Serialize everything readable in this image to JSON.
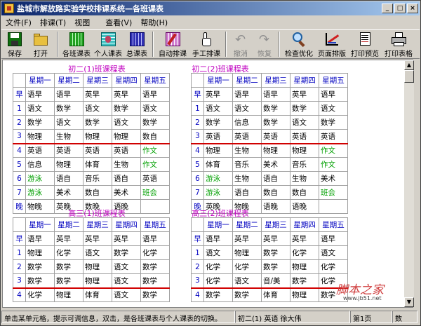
{
  "window": {
    "title": "盐城市解放路实验学校排课系统—各班课表",
    "min": "_",
    "max": "□",
    "close": "×"
  },
  "menu": [
    "文件(F)",
    "排课(T)",
    "视图",
    "查看(V)",
    "帮助(H)"
  ],
  "toolbar": [
    {
      "label": "保存",
      "icon": "save-icon",
      "enabled": true
    },
    {
      "label": "打开",
      "icon": "open-folder-icon",
      "enabled": true
    },
    {
      "label": "各班课表",
      "icon": "class-grid-icon",
      "enabled": true
    },
    {
      "label": "个人课表",
      "icon": "personal-grid-icon",
      "enabled": true
    },
    {
      "label": "总课表",
      "icon": "master-grid-icon",
      "enabled": true
    },
    {
      "label": "自动排课",
      "icon": "auto-schedule-icon",
      "enabled": true
    },
    {
      "label": "手工排课",
      "icon": "hand-pointer-icon",
      "enabled": true
    },
    {
      "label": "撤消",
      "icon": "undo-icon",
      "enabled": false
    },
    {
      "label": "恢复",
      "icon": "redo-icon",
      "enabled": false
    },
    {
      "label": "检查优化",
      "icon": "magnifier-icon",
      "enabled": true
    },
    {
      "label": "页面排版",
      "icon": "page-layout-icon",
      "enabled": true
    },
    {
      "label": "打印预览",
      "icon": "print-preview-icon",
      "enabled": true
    },
    {
      "label": "打印表格",
      "icon": "print-icon",
      "enabled": true
    }
  ],
  "days": [
    "星期一",
    "星期二",
    "星期三",
    "星期四",
    "星期五"
  ],
  "tables": [
    {
      "title": "初二(1)班课程表",
      "rows": [
        {
          "p": "早",
          "c": [
            "语早",
            "语早",
            "英早",
            "英早",
            "语早"
          ]
        },
        {
          "p": "1",
          "c": [
            "语文",
            "数学",
            "语文",
            "数学",
            "语文"
          ]
        },
        {
          "p": "2",
          "c": [
            "数学",
            "语文",
            "数学",
            "语文",
            "数学"
          ]
        },
        {
          "p": "3",
          "c": [
            "物理",
            "生物",
            "物理",
            "物理",
            "数自"
          ]
        },
        {
          "p": "4",
          "c": [
            "英语",
            "英语",
            "英语",
            "英语",
            "作文"
          ]
        },
        {
          "p": "5",
          "c": [
            "信息",
            "物理",
            "体育",
            "生物",
            "作文"
          ]
        },
        {
          "p": "6",
          "c": [
            "游泳",
            "语自",
            "音乐",
            "语自",
            "英语"
          ]
        },
        {
          "p": "7",
          "c": [
            "游泳",
            "美术",
            "数自",
            "美术",
            "班会"
          ]
        },
        {
          "p": "晚",
          "c": [
            "物晚",
            "英晚",
            "数晚",
            "语晚",
            ""
          ]
        }
      ]
    },
    {
      "title": "初二(2)班课程表",
      "rows": [
        {
          "p": "早",
          "c": [
            "英早",
            "语早",
            "语早",
            "英早",
            "语早"
          ]
        },
        {
          "p": "1",
          "c": [
            "语文",
            "语文",
            "数学",
            "数学",
            "语文"
          ]
        },
        {
          "p": "2",
          "c": [
            "数学",
            "信息",
            "数学",
            "语文",
            "数学"
          ]
        },
        {
          "p": "3",
          "c": [
            "英语",
            "英语",
            "英语",
            "英语",
            "英语"
          ]
        },
        {
          "p": "4",
          "c": [
            "物理",
            "生物",
            "物理",
            "物理",
            "作文"
          ]
        },
        {
          "p": "5",
          "c": [
            "体育",
            "音乐",
            "美术",
            "音乐",
            "作文"
          ]
        },
        {
          "p": "6",
          "c": [
            "游泳",
            "生物",
            "语自",
            "生物",
            "美术"
          ]
        },
        {
          "p": "7",
          "c": [
            "游泳",
            "语自",
            "数自",
            "数自",
            "班会"
          ]
        },
        {
          "p": "晚",
          "c": [
            "英晚",
            "物晚",
            "语晚",
            "语晚",
            ""
          ]
        }
      ]
    },
    {
      "title": "",
      "rows": [
        {
          "p": "早",
          "c": [
            "英早"
          ]
        },
        {
          "p": "1",
          "c": [
            "语文"
          ]
        },
        {
          "p": "2",
          "c": [
            "数学"
          ]
        },
        {
          "p": "3",
          "c": [
            "英语"
          ]
        },
        {
          "p": "4",
          "c": [
            "物理"
          ]
        },
        {
          "p": "5",
          "c": [
            "语自"
          ]
        },
        {
          "p": "6",
          "c": [
            "游泳"
          ]
        },
        {
          "p": "7",
          "c": [
            "游泳"
          ]
        },
        {
          "p": "晚",
          "c": [
            "英晚"
          ]
        }
      ]
    },
    {
      "title": "高三(1)班课程表",
      "rows": [
        {
          "p": "早",
          "c": [
            "语早",
            "英早",
            "英早",
            "英早",
            "语早"
          ]
        },
        {
          "p": "1",
          "c": [
            "物理",
            "化学",
            "语文",
            "数学",
            "化学"
          ]
        },
        {
          "p": "2",
          "c": [
            "数学",
            "数学",
            "物理",
            "语文",
            "数学"
          ]
        },
        {
          "p": "3",
          "c": [
            "数学",
            "数学",
            "物理",
            "语文",
            "数学"
          ]
        },
        {
          "p": "4",
          "c": [
            "化学",
            "物理",
            "体育",
            "语文",
            "数学"
          ]
        }
      ]
    },
    {
      "title": "高三(2)班课程表",
      "rows": [
        {
          "p": "早",
          "c": [
            "语早",
            "英早",
            "英早",
            "英早",
            "语早"
          ]
        },
        {
          "p": "1",
          "c": [
            "语文",
            "物理",
            "数学",
            "化学",
            "语文"
          ]
        },
        {
          "p": "2",
          "c": [
            "化学",
            "化学",
            "数学",
            "物理",
            "化学"
          ]
        },
        {
          "p": "3",
          "c": [
            "化学",
            "语文",
            "音/美",
            "数学",
            "化学"
          ]
        },
        {
          "p": "4",
          "c": [
            "数学",
            "数学",
            "体育",
            "物理",
            "数学"
          ]
        }
      ]
    },
    {
      "title": "",
      "rows": [
        {
          "p": "早",
          "c": [
            "英早"
          ]
        },
        {
          "p": "1",
          "c": [
            "英语"
          ]
        },
        {
          "p": "2",
          "c": [
            "英语"
          ]
        },
        {
          "p": "3",
          "c": [
            "英语"
          ]
        },
        {
          "p": "4",
          "c": [
            "物理"
          ]
        }
      ]
    }
  ],
  "status": {
    "hint": "单击某单元格，提示可调信息，双击，是各班课表与个人课表的切换。",
    "cell": "初二(1) 英语 徐大伟",
    "page": "第1页",
    "mode": "数"
  },
  "watermark": {
    "text": "脚本之家",
    "url": "www.jb51.net"
  },
  "colors": {
    "titlebar": "#0a246a",
    "header_text": "#0000c0",
    "title_text": "#c000c0",
    "highlight": "#00a000",
    "noon_line": "#d00000"
  }
}
